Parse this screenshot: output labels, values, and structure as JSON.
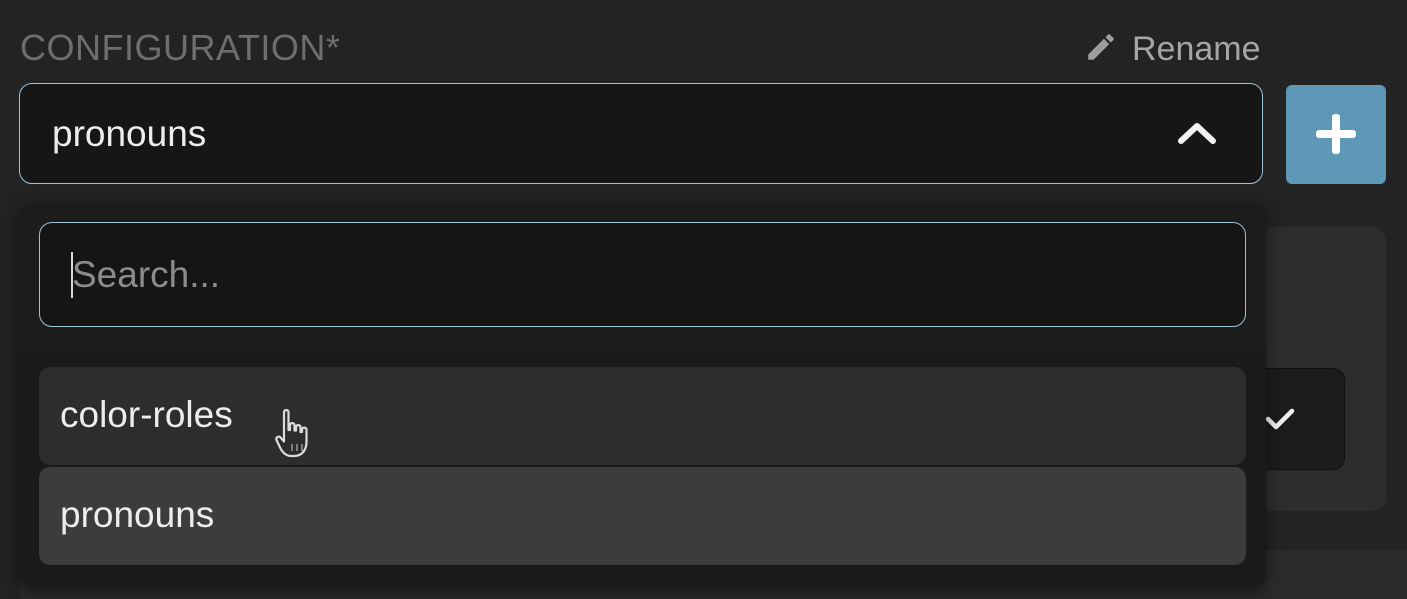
{
  "config": {
    "label": "CONFIGURATION*",
    "rename_label": "Rename",
    "selected_value": "pronouns"
  },
  "search": {
    "placeholder": "Search...",
    "value": ""
  },
  "options": [
    {
      "label": "color-roles",
      "hovered": true
    },
    {
      "label": "pronouns",
      "selected": true
    }
  ],
  "icons": {
    "rename": "pencil-icon",
    "chevron": "chevron-up-icon",
    "add": "plus-icon",
    "confirm": "checkmark-icon",
    "cursor": "hand-pointer-icon"
  },
  "colors": {
    "accent_border": "#9cc2d6",
    "add_button": "#5f97b7",
    "background": "#232323",
    "text": "#ededed",
    "muted_text": "#6e6e6e"
  }
}
